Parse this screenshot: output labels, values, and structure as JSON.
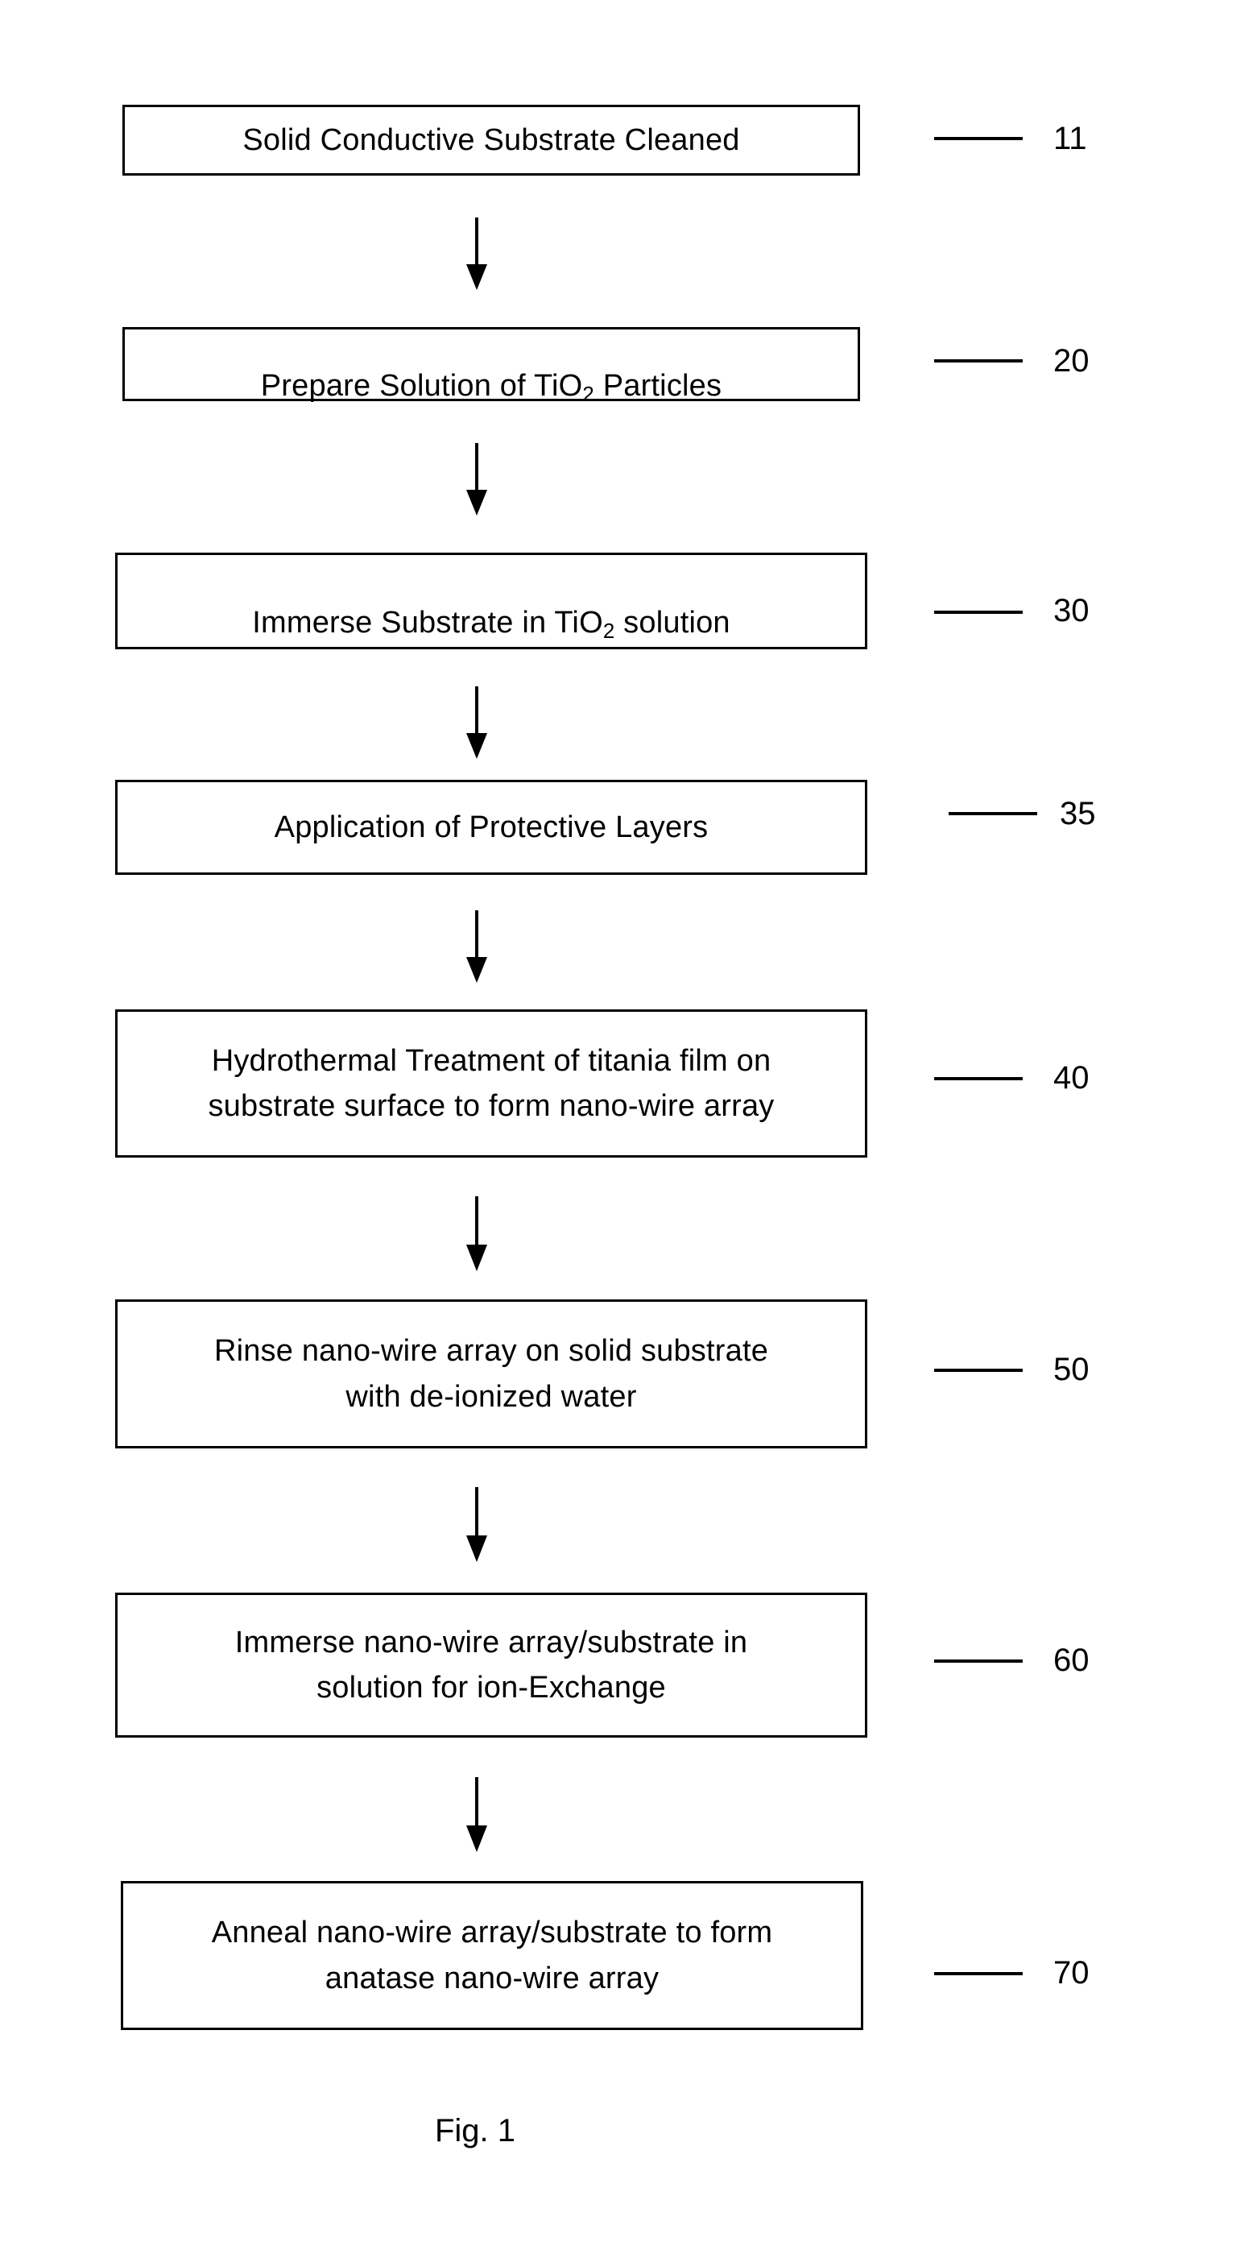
{
  "figure": {
    "caption": "Fig. 1",
    "type": "process-flowchart"
  },
  "steps": [
    {
      "id": "step-11",
      "ref": "11",
      "lines": [
        "Solid Conductive Substrate Cleaned"
      ],
      "has_subscript": false
    },
    {
      "id": "step-20",
      "ref": "20",
      "lines": [
        "Prepare Solution of TiO2 Particles"
      ],
      "has_subscript": true,
      "rich": {
        "before": "Prepare Solution of TiO",
        "sub": "2",
        "after": " Particles"
      }
    },
    {
      "id": "step-30",
      "ref": "30",
      "lines": [
        "Immerse Substrate in TiO2 solution"
      ],
      "has_subscript": true,
      "rich": {
        "before": "Immerse Substrate in TiO",
        "sub": "2",
        "after": " solution"
      }
    },
    {
      "id": "step-35",
      "ref": "35",
      "lines": [
        "Application of Protective Layers"
      ],
      "has_subscript": false
    },
    {
      "id": "step-40",
      "ref": "40",
      "lines": [
        "Hydrothermal Treatment of titania film on",
        "substrate surface to form nano-wire array"
      ],
      "has_subscript": false
    },
    {
      "id": "step-50",
      "ref": "50",
      "lines": [
        "Rinse nano-wire array on solid substrate",
        "with de-ionized water"
      ],
      "has_subscript": false
    },
    {
      "id": "step-60",
      "ref": "60",
      "lines": [
        "Immerse nano-wire array/substrate in",
        "solution for ion-Exchange"
      ],
      "has_subscript": false
    },
    {
      "id": "step-70",
      "ref": "70",
      "lines": [
        "Anneal nano-wire array/substrate to form",
        "anatase nano-wire array"
      ],
      "has_subscript": false
    }
  ],
  "connectors": [
    {
      "from": "step-11",
      "to": "step-20",
      "kind": "down-arrow"
    },
    {
      "from": "step-20",
      "to": "step-30",
      "kind": "down-arrow"
    },
    {
      "from": "step-30",
      "to": "step-35",
      "kind": "down-arrow"
    },
    {
      "from": "step-35",
      "to": "step-40",
      "kind": "down-arrow"
    },
    {
      "from": "step-40",
      "to": "step-50",
      "kind": "down-arrow"
    },
    {
      "from": "step-50",
      "to": "step-60",
      "kind": "down-arrow"
    },
    {
      "from": "step-60",
      "to": "step-70",
      "kind": "down-arrow"
    }
  ],
  "colors": {
    "background": "#ffffff",
    "ink": "#000000"
  }
}
